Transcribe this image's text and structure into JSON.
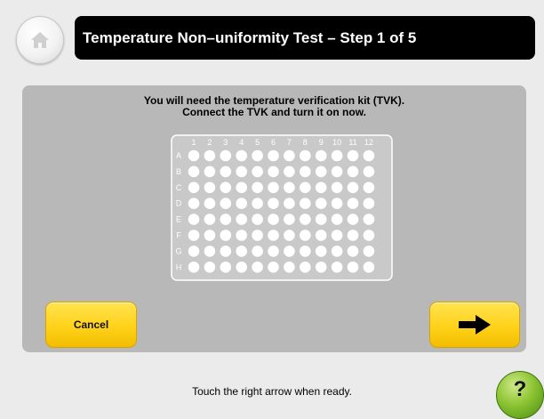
{
  "header": {
    "title": "Temperature Non–uniformity Test – Step 1 of 5",
    "home_icon": "home-icon"
  },
  "instructions": {
    "line1": "You will need the temperature verification kit (TVK).",
    "line2": "Connect the TVK and turn it on now."
  },
  "plate": {
    "columns": [
      "1",
      "2",
      "3",
      "4",
      "5",
      "6",
      "7",
      "8",
      "9",
      "10",
      "11",
      "12"
    ],
    "rows": [
      "A",
      "B",
      "C",
      "D",
      "E",
      "F",
      "G",
      "H"
    ]
  },
  "buttons": {
    "cancel_label": "Cancel",
    "next_icon": "right-arrow-icon",
    "help_label": "?"
  },
  "footer": {
    "hint": "Touch the right arrow when ready."
  },
  "colors": {
    "title_bar": "#000000",
    "panel": "#b8b8b8",
    "button_yellow": "#ffd21a",
    "help_green": "#8cc432"
  }
}
